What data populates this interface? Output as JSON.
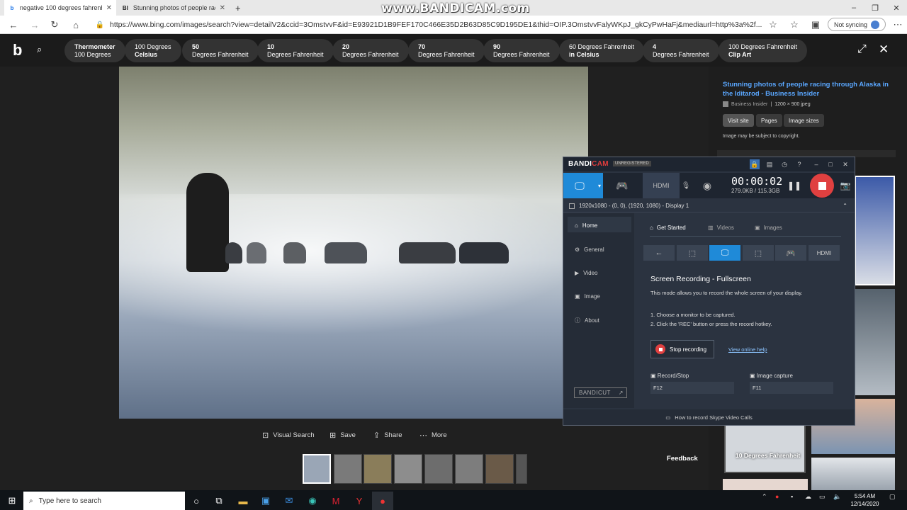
{
  "watermark": "www.BANDICAM.com",
  "tabs": [
    {
      "icon": "b",
      "label": "negative 100 degrees fahrenheit"
    },
    {
      "icon": "BI",
      "label": "Stunning photos of people racing"
    }
  ],
  "address": {
    "url": "https://www.bing.com/images/search?view=detailV2&ccid=3OmstvvF&id=E93921D1B9FEF170C466E35D2B63D85C9D195DE1&thid=OIP.3OmstvvFalyWKpJ_gkCyPwHaFj&mediaurl=http%3a%2f...",
    "sync": "Not syncing"
  },
  "pills": [
    {
      "a": "Thermometer",
      "b": "100 Degrees"
    },
    {
      "a": "100 Degrees",
      "b": "Celsius"
    },
    {
      "a": "50",
      "b": "Degrees Fahrenheit"
    },
    {
      "a": "10",
      "b": "Degrees Fahrenheit"
    },
    {
      "a": "20",
      "b": "Degrees Fahrenheit"
    },
    {
      "a": "70",
      "b": "Degrees Fahrenheit"
    },
    {
      "a": "90",
      "b": "Degrees Fahrenheit"
    },
    {
      "a": "60 Degrees Fahrenheit",
      "b": "in Celsius"
    },
    {
      "a": "4",
      "b": "Degrees Fahrenheit"
    },
    {
      "a": "100 Degrees Fahrenheit",
      "b": "Clip Art"
    }
  ],
  "actions": {
    "visual_search": "Visual Search",
    "save": "Save",
    "share": "Share",
    "more": "More"
  },
  "feedback": "Feedback",
  "right": {
    "title": "Stunning photos of people racing through Alaska in the Iditarod - Business Insider",
    "source": "Business Insider",
    "dims": "1200 × 900 jpeg",
    "visit": "Visit site",
    "pages": "Pages",
    "sizes": "Image sizes",
    "note": "Image may be subject to copyright.",
    "overlay": "10 Degrees Fahrenheit"
  },
  "bandicam": {
    "logo_a": "BANDI",
    "logo_b": "CAM",
    "reg": "UNREGISTERED",
    "timer": "00:00:02",
    "size": "279.0KB / 115.3GB",
    "display": "1920x1080 - (0, 0), (1920, 1080) - Display 1",
    "side": [
      "Home",
      "General",
      "Video",
      "Image",
      "About"
    ],
    "bandicut": "BANDICUT",
    "tabs": [
      "Get Started",
      "Videos",
      "Images"
    ],
    "title": "Screen Recording - Fullscreen",
    "desc": "This mode allows you to record the whole screen of your display.",
    "step1": "1. Choose a monitor to be captured.",
    "step2": "2. Click the 'REC' button or press the record hotkey.",
    "stop": "Stop recording",
    "help": "View online help",
    "hk1": "Record/Stop",
    "hk1v": "F12",
    "hk2": "Image capture",
    "hk2v": "F11",
    "footer": "How to record Skype Video Calls"
  },
  "taskbar": {
    "search": "Type here to search",
    "time": "5:54 AM",
    "date": "12/14/2020"
  }
}
